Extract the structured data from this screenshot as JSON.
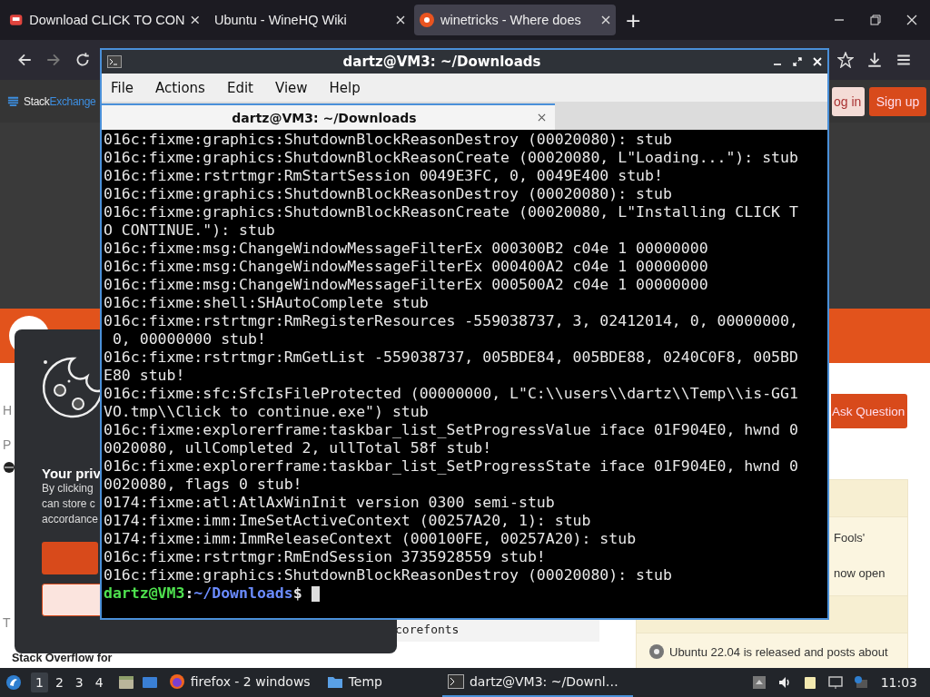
{
  "browser": {
    "tabs": [
      {
        "title": "Download CLICK TO CON",
        "kind": "download",
        "selected": false
      },
      {
        "title": "Ubuntu - WineHQ Wiki",
        "kind": "plain",
        "selected": false
      },
      {
        "title": "winetricks - Where does",
        "kind": "ask",
        "selected": true
      }
    ],
    "new_tab": "+"
  },
  "site": {
    "brand": "Stack",
    "brand_2": "Exchange",
    "login": "og in",
    "signup": "Sign up",
    "ask_button": "Ask Question",
    "left_nav": [
      "H",
      "P"
    ],
    "left_footer": "T",
    "footer_card": "Stack Overflow for",
    "code": "corefonts",
    "sidebar": [
      "Fools'",
      "now open",
      "Ubuntu 22.04 is released and posts about"
    ]
  },
  "cookie_dialog": {
    "title": "Your priv",
    "lines": [
      "By clicking",
      "can store c",
      "accordance"
    ]
  },
  "terminal": {
    "title": "dartz@VM3: ~/Downloads",
    "menu": [
      "File",
      "Actions",
      "Edit",
      "View",
      "Help"
    ],
    "tabs": [
      {
        "title": "dartz@VM3: ~/Downloads",
        "selected": true
      }
    ],
    "lines": [
      "016c:fixme:graphics:ShutdownBlockReasonDestroy (00020080): stub",
      "016c:fixme:graphics:ShutdownBlockReasonCreate (00020080, L\"Loading...\"): stub",
      "016c:fixme:rstrtmgr:RmStartSession 0049E3FC, 0, 0049E400 stub!",
      "016c:fixme:graphics:ShutdownBlockReasonDestroy (00020080): stub",
      "016c:fixme:graphics:ShutdownBlockReasonCreate (00020080, L\"Installing CLICK T",
      "O CONTINUE.\"): stub",
      "016c:fixme:msg:ChangeWindowMessageFilterEx 000300B2 c04e 1 00000000",
      "016c:fixme:msg:ChangeWindowMessageFilterEx 000400A2 c04e 1 00000000",
      "016c:fixme:msg:ChangeWindowMessageFilterEx 000500A2 c04e 1 00000000",
      "016c:fixme:shell:SHAutoComplete stub",
      "016c:fixme:rstrtmgr:RmRegisterResources -559038737, 3, 02412014, 0, 00000000,",
      " 0, 00000000 stub!",
      "016c:fixme:rstrtmgr:RmGetList -559038737, 005BDE84, 005BDE88, 0240C0F8, 005BD",
      "E80 stub!",
      "016c:fixme:sfc:SfcIsFileProtected (00000000, L\"C:\\\\users\\\\dartz\\\\Temp\\\\is-GG1",
      "VO.tmp\\\\Click to continue.exe\") stub",
      "016c:fixme:explorerframe:taskbar_list_SetProgressValue iface 01F904E0, hwnd 0",
      "0020080, ullCompleted 2, ullTotal 58f stub!",
      "016c:fixme:explorerframe:taskbar_list_SetProgressState iface 01F904E0, hwnd 0",
      "0020080, flags 0 stub!",
      "0174:fixme:atl:AtlAxWinInit version 0300 semi-stub",
      "0174:fixme:imm:ImeSetActiveContext (00257A20, 1): stub",
      "0174:fixme:imm:ImmReleaseContext (000100FE, 00257A20): stub",
      "016c:fixme:rstrtmgr:RmEndSession 3735928559 stub!",
      "016c:fixme:graphics:ShutdownBlockReasonDestroy (00020080): stub"
    ],
    "prompt": {
      "user": "dartz@VM3",
      "sep": ":",
      "path": "~/Downloads",
      "symbol": "$"
    }
  },
  "taskbar": {
    "workspaces": [
      {
        "label": "1",
        "selected": true
      },
      {
        "label": "2",
        "selected": false
      },
      {
        "label": "3",
        "selected": false
      },
      {
        "label": "4",
        "selected": false
      }
    ],
    "tasks": [
      {
        "title": "firefox - 2 windows",
        "kind": "firefox",
        "selected": false
      },
      {
        "title": "Temp",
        "kind": "folder",
        "selected": false
      },
      {
        "title": "dartz@VM3: ~/Downl…",
        "kind": "terminal",
        "selected": true
      }
    ],
    "clock": "11:03"
  }
}
